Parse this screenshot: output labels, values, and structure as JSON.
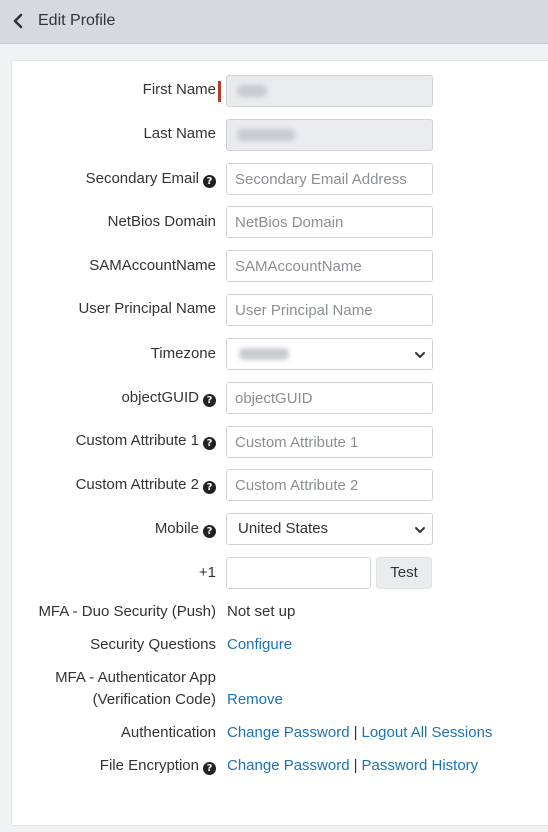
{
  "header": {
    "title": "Edit Profile"
  },
  "form": {
    "first_name": {
      "label": "First Name"
    },
    "last_name": {
      "label": "Last Name"
    },
    "secondary_email": {
      "label": "Secondary Email",
      "placeholder": "Secondary Email Address"
    },
    "netbios": {
      "label": "NetBios Domain",
      "placeholder": "NetBios Domain"
    },
    "sam": {
      "label": "SAMAccountName",
      "placeholder": "SAMAccountName"
    },
    "upn": {
      "label": "User Principal Name",
      "placeholder": "User Principal Name"
    },
    "timezone": {
      "label": "Timezone"
    },
    "objectguid": {
      "label": "objectGUID",
      "placeholder": "objectGUID"
    },
    "custom1": {
      "label": "Custom Attribute 1",
      "placeholder": "Custom Attribute 1"
    },
    "custom2": {
      "label": "Custom Attribute 2",
      "placeholder": "Custom Attribute 2"
    },
    "mobile": {
      "label": "Mobile",
      "country": "United States",
      "prefix": "+1",
      "test_label": "Test"
    },
    "mfa_duo": {
      "label": "MFA - Duo Security (Push)",
      "value": "Not set up"
    },
    "security_questions": {
      "label": "Security Questions",
      "link": "Configure"
    },
    "mfa_app": {
      "label_line1": "MFA - Authenticator App",
      "label_line2": "(Verification Code)",
      "link": "Remove"
    },
    "authentication": {
      "label": "Authentication",
      "link1": "Change Password",
      "separator": "|",
      "link2": "Logout All Sessions"
    },
    "file_encryption": {
      "label": "File Encryption",
      "link1": "Change Password",
      "separator": "|",
      "link2": "Password History"
    }
  },
  "icons": {
    "back": "chevron-left-icon",
    "help": "question-circle-icon",
    "dropdown": "chevron-down-icon"
  },
  "colors": {
    "link": "#1a73b8",
    "required": "#c0392b",
    "header_bg": "#d6d9dd"
  }
}
